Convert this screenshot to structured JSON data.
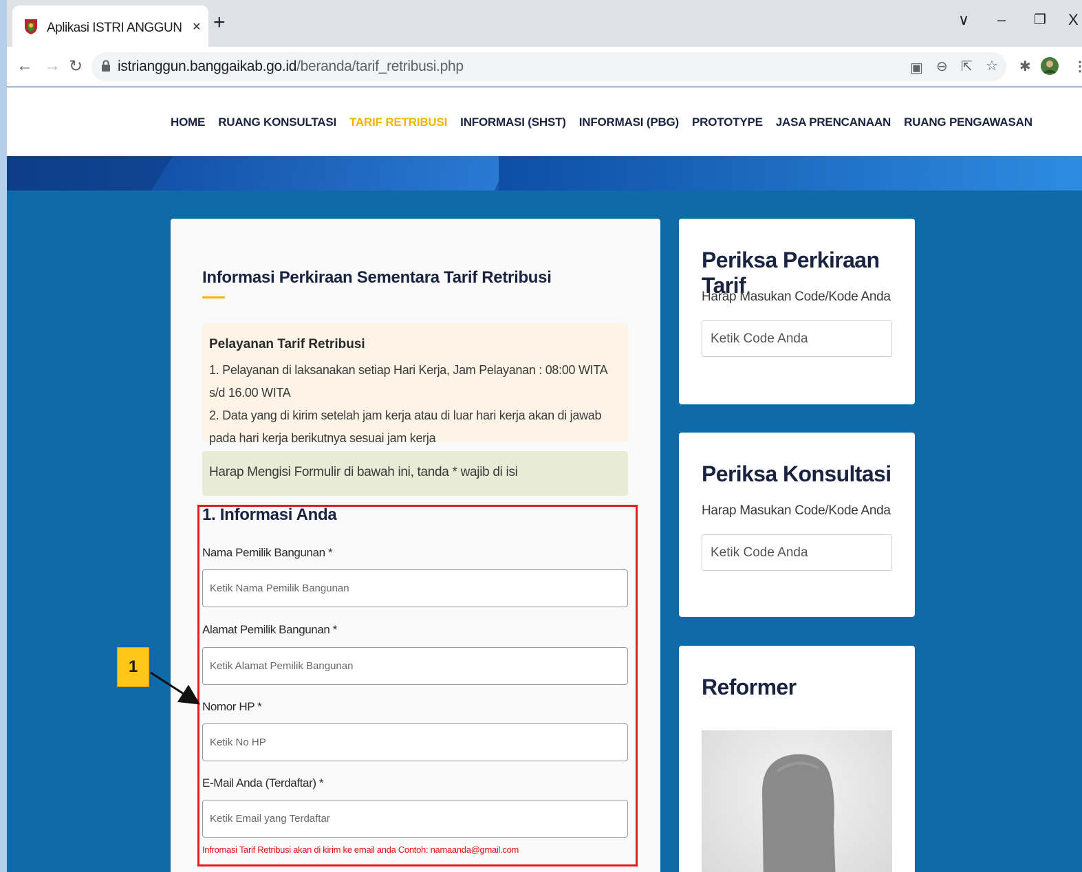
{
  "browser": {
    "tab_title": "Aplikasi ISTRI ANGGUN",
    "tab_close": "×",
    "new_tab": "+",
    "url_domain": "istrianggun.banggaikab.go.id",
    "url_path": "/beranda/tarif_retribusi.php",
    "window_controls": [
      "∨",
      "–",
      "❐",
      "X"
    ]
  },
  "nav": {
    "items": [
      {
        "label": "HOME"
      },
      {
        "label": "RUANG KONSULTASI"
      },
      {
        "label": "TARIF RETRIBUSI",
        "active": true
      },
      {
        "label": "INFORMASI (SHST)"
      },
      {
        "label": "INFORMASI (PBG)"
      },
      {
        "label": "PROTOTYPE"
      },
      {
        "label": "JASA PRENCANAAN"
      },
      {
        "label": "RUANG PENGAWASAN"
      }
    ]
  },
  "main": {
    "title": "Informasi Perkiraan Sementara Tarif Retribusi",
    "notice": {
      "title": "Pelayanan Tarif Retribusi",
      "line1": "1. Pelayanan di laksanakan setiap Hari Kerja, Jam Pelayanan : 08:00 WITA s/d 16.00 WITA",
      "line2": "2. Data yang di kirim setelah jam kerja atau di luar hari kerja akan di jawab pada hari kerja berikutnya sesuai jam kerja"
    },
    "form_note": "Harap Mengisi Formulir di bawah ini, tanda * wajib di isi",
    "section_title": "1. Informasi Anda",
    "fields": [
      {
        "label": "Nama Pemilik Bangunan *",
        "placeholder": "Ketik Nama Pemilik Bangunan"
      },
      {
        "label": "Alamat Pemilik Bangunan *",
        "placeholder": "Ketik Alamat Pemilik Bangunan"
      },
      {
        "label": "Nomor HP *",
        "placeholder": "Ketik No HP"
      },
      {
        "label": "E-Mail Anda (Terdaftar) *",
        "placeholder": "Ketik Email yang Terdaftar"
      }
    ],
    "email_hint": "Infromasi Tarif Retribusi akan di kirim ke email anda Contoh: namaanda@gmail.com"
  },
  "sidebar": {
    "tarif": {
      "title": "Periksa Perkiraan Tarif",
      "subtitle": "Harap Masukan Code/Kode Anda",
      "placeholder": "Ketik Code Anda"
    },
    "konsultasi": {
      "title": "Periksa Konsultasi",
      "subtitle": "Harap Masukan Code/Kode Anda",
      "placeholder": "Ketik Code Anda"
    },
    "reformer": {
      "title": "Reformer"
    }
  },
  "annotation": {
    "label": "1"
  },
  "colors": {
    "accent": "#f4b400",
    "page_bg": "#0f6aa8",
    "highlight_box": "#e31b1b",
    "callout": "#ffc61a"
  }
}
